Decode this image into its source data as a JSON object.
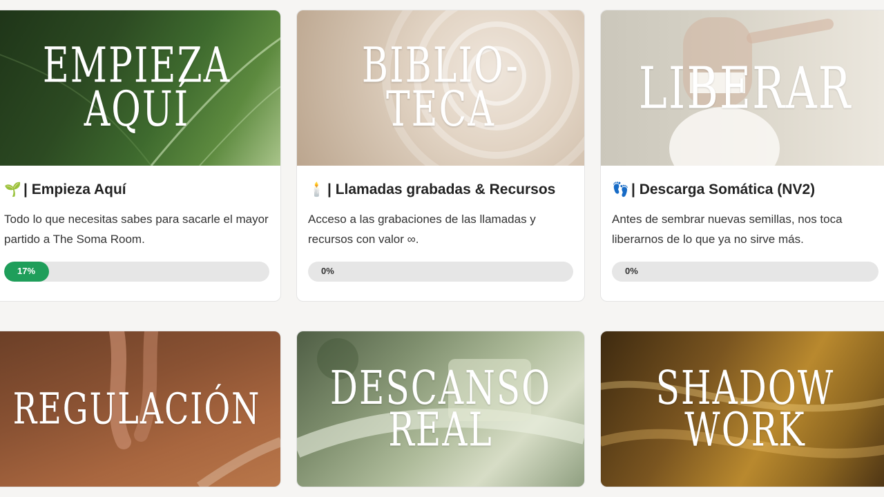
{
  "courses": [
    {
      "cover_title": "EMPIEZA\nAQUÍ",
      "icon": "seedling-icon",
      "emoji": "🌱",
      "title": "| Empieza Aquí",
      "description": "Todo lo que necesitas sabes para sacarle el mayor partido a The Soma Room.",
      "progress": 17,
      "progress_label": "17%"
    },
    {
      "cover_title": "BIBLIO-\nTECA",
      "icon": "candle-icon",
      "emoji": "🕯️",
      "title": "| Llamadas grabadas & Recursos",
      "description": "Acceso a las grabaciones de las llamadas y recursos con valor ∞.",
      "progress": 0,
      "progress_label": "0%"
    },
    {
      "cover_title": "LIBERAR",
      "icon": "footprints-icon",
      "emoji": "👣",
      "title": "| Descarga Somática (NV2)",
      "description": "Antes de sembrar nuevas semillas, nos toca liberarnos de lo que ya no sirve más.",
      "progress": 0,
      "progress_label": "0%"
    },
    {
      "cover_title": "REGULACIÓN"
    },
    {
      "cover_title": "DESCANSO\nREAL"
    },
    {
      "cover_title": "SHADOW\nWORK"
    }
  ],
  "colors": {
    "progress_fill": "#1f9e5a",
    "progress_track": "#e6e6e6"
  }
}
